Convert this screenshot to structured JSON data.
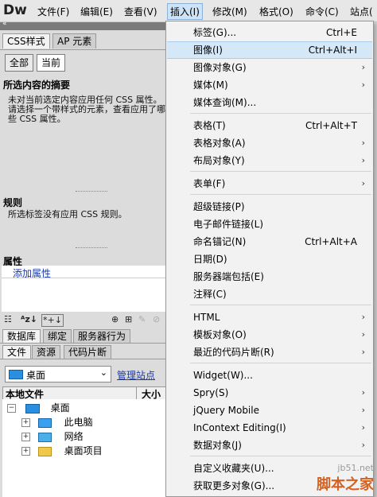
{
  "menubar": {
    "logo": "Dw",
    "items": [
      "文件(F)",
      "编辑(E)",
      "查看(V)",
      "插入(I)",
      "修改(M)",
      "格式(O)",
      "命令(C)",
      "站点("
    ]
  },
  "panel": {
    "collapse_glyph": "«",
    "tabs": [
      "CSS样式",
      "AP 元素"
    ],
    "mode_buttons": [
      "全部",
      "当前"
    ],
    "summary_title": "所选内容的摘要",
    "summary_text": "未对当前选定内容应用任何 CSS 属性。请选择一个带样式的元素，查看应用了哪些 CSS 属性。",
    "rules_title": "规则",
    "rules_text": "所选标签没有应用 CSS 规则。",
    "props_title": "属性",
    "add_property": "添加属性",
    "toolbar_icons": [
      "list-view-icon",
      "az-sort-icon",
      "set-properties-icon",
      "link-icon",
      "new-rule-icon",
      "edit-rule-icon",
      "disable-icon"
    ],
    "files_tabs_row1": [
      "数据库",
      "绑定",
      "服务器行为"
    ],
    "files_tabs_row2": [
      "文件",
      "资源",
      "代码片断"
    ],
    "site_select": "桌面",
    "manage_site": "管理站点",
    "col_local": "本地文件",
    "col_size": "大小",
    "tree": [
      {
        "label": "桌面",
        "level": 0,
        "icon": "desktop-icon"
      },
      {
        "label": "此电脑",
        "level": 1,
        "icon": "computer-icon"
      },
      {
        "label": "网络",
        "level": 1,
        "icon": "network-icon"
      },
      {
        "label": "桌面项目",
        "level": 1,
        "icon": "folder-icon"
      }
    ]
  },
  "dropdown": {
    "items": [
      {
        "label": "标签(G)...",
        "shortcut": "Ctrl+E",
        "submenu": false
      },
      {
        "label": "图像(I)",
        "shortcut": "Ctrl+Alt+I",
        "submenu": false,
        "highlighted": true
      },
      {
        "label": "图像对象(G)",
        "shortcut": "",
        "submenu": true
      },
      {
        "label": "媒体(M)",
        "shortcut": "",
        "submenu": true
      },
      {
        "label": "媒体查询(M)...",
        "shortcut": "",
        "submenu": false,
        "sep_after": true
      },
      {
        "label": "表格(T)",
        "shortcut": "Ctrl+Alt+T",
        "submenu": false
      },
      {
        "label": "表格对象(A)",
        "shortcut": "",
        "submenu": true
      },
      {
        "label": "布局对象(Y)",
        "shortcut": "",
        "submenu": true,
        "sep_after": true
      },
      {
        "label": "表单(F)",
        "shortcut": "",
        "submenu": true,
        "sep_after": true
      },
      {
        "label": "超级链接(P)",
        "shortcut": "",
        "submenu": false
      },
      {
        "label": "电子邮件链接(L)",
        "shortcut": "",
        "submenu": false
      },
      {
        "label": "命名锚记(N)",
        "shortcut": "Ctrl+Alt+A",
        "submenu": false
      },
      {
        "label": "日期(D)",
        "shortcut": "",
        "submenu": false
      },
      {
        "label": "服务器端包括(E)",
        "shortcut": "",
        "submenu": false
      },
      {
        "label": "注释(C)",
        "shortcut": "",
        "submenu": false,
        "sep_after": true
      },
      {
        "label": "HTML",
        "shortcut": "",
        "submenu": true
      },
      {
        "label": "模板对象(O)",
        "shortcut": "",
        "submenu": true
      },
      {
        "label": "最近的代码片断(R)",
        "shortcut": "",
        "submenu": true,
        "sep_after": true
      },
      {
        "label": "Widget(W)...",
        "shortcut": "",
        "submenu": false
      },
      {
        "label": "Spry(S)",
        "shortcut": "",
        "submenu": true
      },
      {
        "label": "jQuery Mobile",
        "shortcut": "",
        "submenu": true
      },
      {
        "label": "InContext Editing(I)",
        "shortcut": "",
        "submenu": true
      },
      {
        "label": "数据对象(J)",
        "shortcut": "",
        "submenu": true,
        "sep_after": true
      },
      {
        "label": "自定义收藏夹(U)...",
        "shortcut": "",
        "submenu": false
      },
      {
        "label": "获取更多对象(G)...",
        "shortcut": "",
        "submenu": false
      }
    ]
  },
  "watermark": {
    "line1": "jb51.net",
    "line2": "脚本之家"
  },
  "colors": {
    "highlight": "#d5e8f8",
    "menu_bg": "#f2f2f2",
    "link": "#1a3aa8"
  }
}
